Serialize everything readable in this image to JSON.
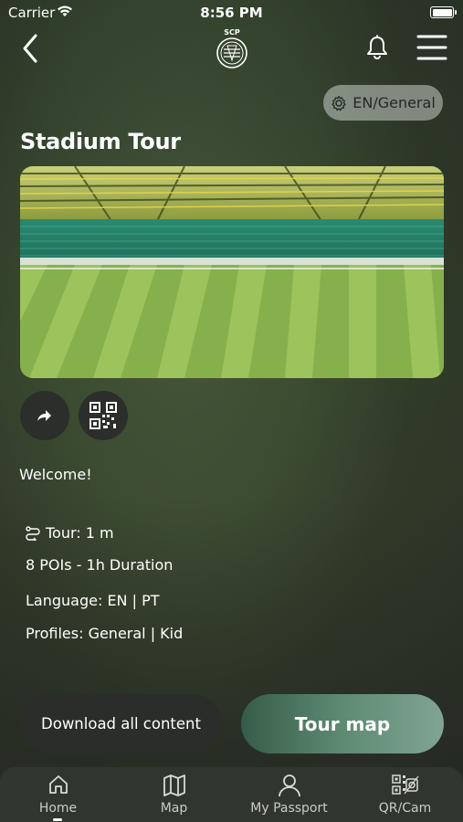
{
  "status_bar": {
    "carrier": "Carrier",
    "time": "8:56 PM"
  },
  "header": {
    "logo_text": "SCP",
    "language_chip": "EN/General"
  },
  "tour": {
    "title": "Stadium Tour",
    "welcome": "Welcome!",
    "tour_label": "Tour: 1 m",
    "pois": "8 POIs - 1h Duration",
    "language": "Language: EN | PT",
    "profiles": "Profiles: General | Kid"
  },
  "actions": {
    "download_label": "Download all content",
    "tour_map_label": "Tour map"
  },
  "tabs": [
    {
      "label": "Home",
      "icon": "home-icon"
    },
    {
      "label": "Map",
      "icon": "map-icon"
    },
    {
      "label": "My Passport",
      "icon": "user-icon"
    },
    {
      "label": "QR/Cam",
      "icon": "qr-camera-icon"
    }
  ],
  "colors": {
    "accent_green": "#5e8a72",
    "dark_button": "#2a2d29"
  }
}
